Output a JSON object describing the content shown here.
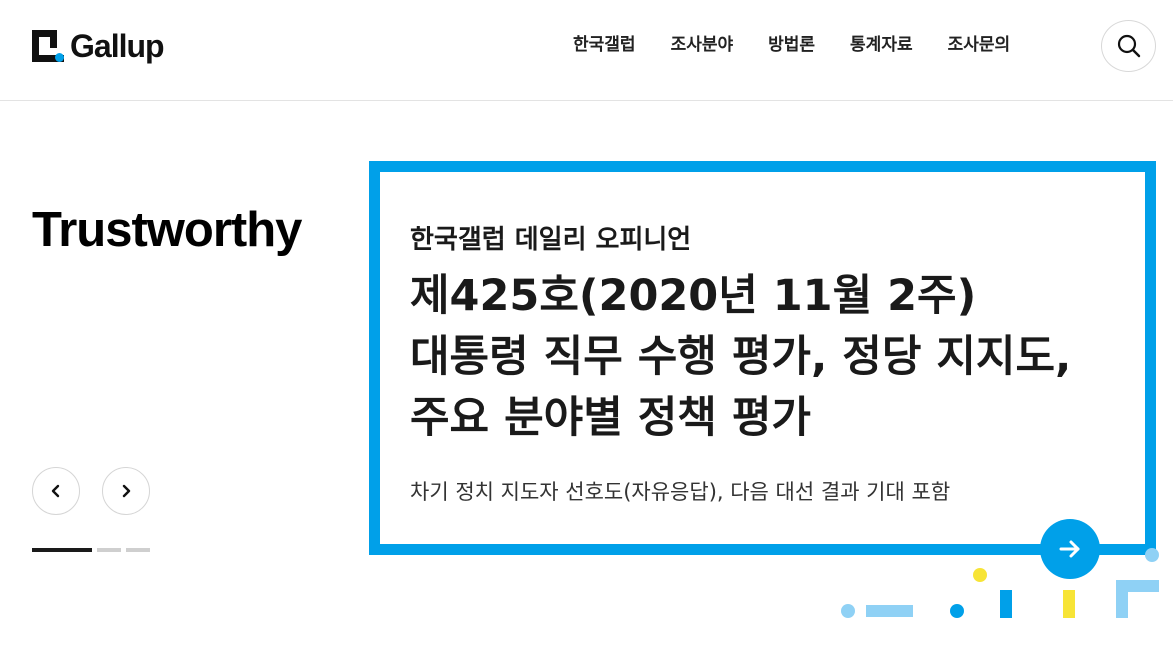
{
  "header": {
    "logo_text": "Gallup",
    "nav": [
      "한국갤럽",
      "조사분야",
      "방법론",
      "통계자료",
      "조사문의"
    ],
    "search_icon": "search-icon"
  },
  "hero": {
    "headline": "Trustworthy",
    "prev_icon": "chevron-left-icon",
    "next_icon": "chevron-right-icon",
    "slides_total": 3,
    "slide_current": 1
  },
  "feature": {
    "kicker": "한국갤럽 데일리 오피니언",
    "title_lines": [
      "제425호(2020년 11월 2주)",
      "대통령 직무 수행 평가, 정당 지지도,",
      "주요 분야별 정책 평가"
    ],
    "subtitle": "차기 정치 지도자 선호도(자유응답), 다음 대선 결과 기대 포함",
    "go_icon": "arrow-right-icon"
  },
  "colors": {
    "accent": "#00a0e9",
    "accent_light": "#8fd1f5",
    "yellow": "#f7e436",
    "dark": "#1a1a1a",
    "gray": "#cfcfcf"
  }
}
